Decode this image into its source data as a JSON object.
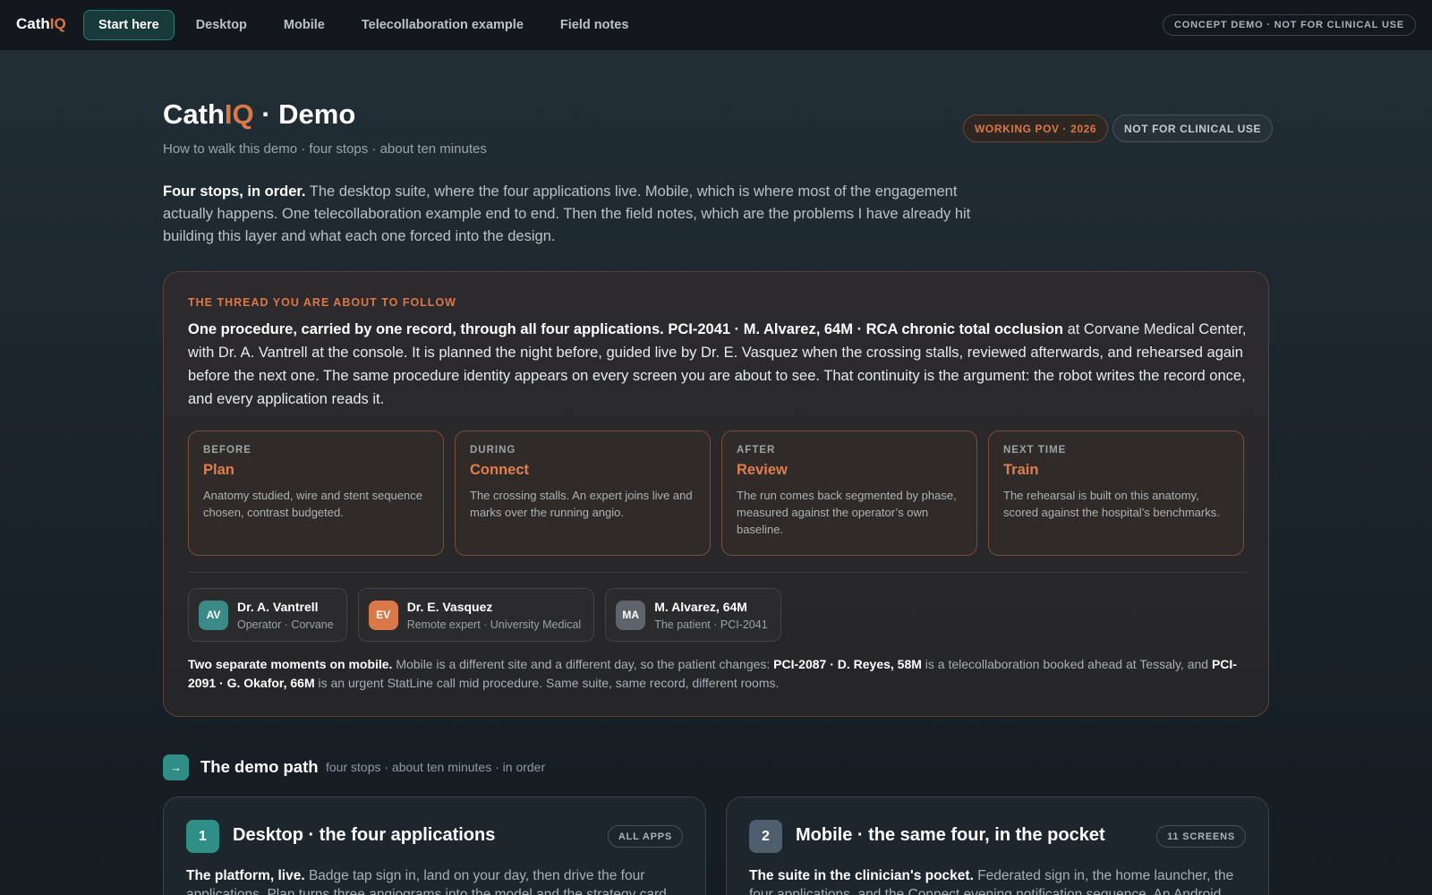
{
  "nav": {
    "brand_prefix": "Cath",
    "brand_suffix": "IQ",
    "items": [
      {
        "label": "Start here"
      },
      {
        "label": "Desktop"
      },
      {
        "label": "Mobile"
      },
      {
        "label": "Telecollaboration example"
      },
      {
        "label": "Field notes"
      }
    ],
    "active_index": 0,
    "concept_pill": "CONCEPT DEMO · NOT FOR CLINICAL USE"
  },
  "header": {
    "title_prefix": "Cath",
    "title_accent": "IQ",
    "title_suffix": " · Demo",
    "subtitle": "How to walk this demo · four stops · about ten minutes",
    "pill_pov": "WORKING POV · 2026",
    "pill_nfc": "NOT FOR CLINICAL USE"
  },
  "intro": {
    "lead": "Four stops, in order.",
    "body": " The desktop suite, where the four applications live. Mobile, which is where most of the engagement actually happens. One telecollaboration example end to end. Then the field notes, which are the problems I have already hit building this layer and what each one forced into the design."
  },
  "thread": {
    "kicker": "THE THREAD YOU ARE ABOUT TO FOLLOW",
    "lead": "One procedure, carried by one record, through all four applications. PCI-2041 · M. Alvarez, 64M · RCA chronic total occlusion",
    "body": " at Corvane Medical Center, with Dr. A. Vantrell at the console. It is planned the night before, guided live by Dr. E. Vasquez when the crossing stalls, reviewed afterwards, and rehearsed again before the next one. The same procedure identity appears on every screen you are about to see. That continuity is the argument: the robot writes the record once, and every application reads it.",
    "phases": [
      {
        "when": "BEFORE",
        "name": "Plan",
        "desc": "Anatomy studied, wire and stent sequence chosen, contrast budgeted."
      },
      {
        "when": "DURING",
        "name": "Connect",
        "desc": "The crossing stalls. An expert joins live and marks over the running angio."
      },
      {
        "when": "AFTER",
        "name": "Review",
        "desc": "The run comes back segmented by phase, measured against the operator’s own baseline."
      },
      {
        "when": "NEXT TIME",
        "name": "Train",
        "desc": "The rehearsal is built on this anatomy, scored against the hospital’s benchmarks."
      }
    ],
    "people": [
      {
        "initials": "AV",
        "name": "Dr. A. Vantrell",
        "role": "Operator · Corvane"
      },
      {
        "initials": "EV",
        "name": "Dr. E. Vasquez",
        "role": "Remote expert · University Medical"
      },
      {
        "initials": "MA",
        "name": "M. Alvarez, 64M",
        "role": "The patient · PCI-2041"
      }
    ],
    "mobile_note": {
      "lead": "Two separate moments on mobile.",
      "part1": " Mobile is a different site and a different day, so the patient changes: ",
      "case1": "PCI-2087 · D. Reyes, 58M",
      "part2": " is a telecollaboration booked ahead at Tessaly, and ",
      "case2": "PCI-2091 · G. Okafor, 66M",
      "part3": " is an urgent StatLine call mid procedure. Same suite, same record, different rooms."
    }
  },
  "demo_path": {
    "icon": "arrow-right-icon",
    "arrow": "→",
    "title": "The demo path",
    "subtitle": "four stops · about ten minutes · in order",
    "stops": [
      {
        "number": "1",
        "title": "Desktop · the four applications",
        "badge": "ALL APPS",
        "lead": "The platform, live.",
        "body": " Badge tap sign in, land on your day, then drive the four applications. Plan turns three angiograms into the model and the strategy card."
      },
      {
        "number": "2",
        "title": "Mobile · the same four, in the pocket",
        "badge": "11 SCREENS",
        "lead": "The suite in the clinician's pocket.",
        "body": " Federated sign in, the home launcher, the four applications, and the Connect evening notification sequence. An Android Material build."
      }
    ]
  },
  "colors": {
    "accent_orange": "#d9794a",
    "accent_teal": "#2f8f86",
    "background": "#1b252c"
  }
}
